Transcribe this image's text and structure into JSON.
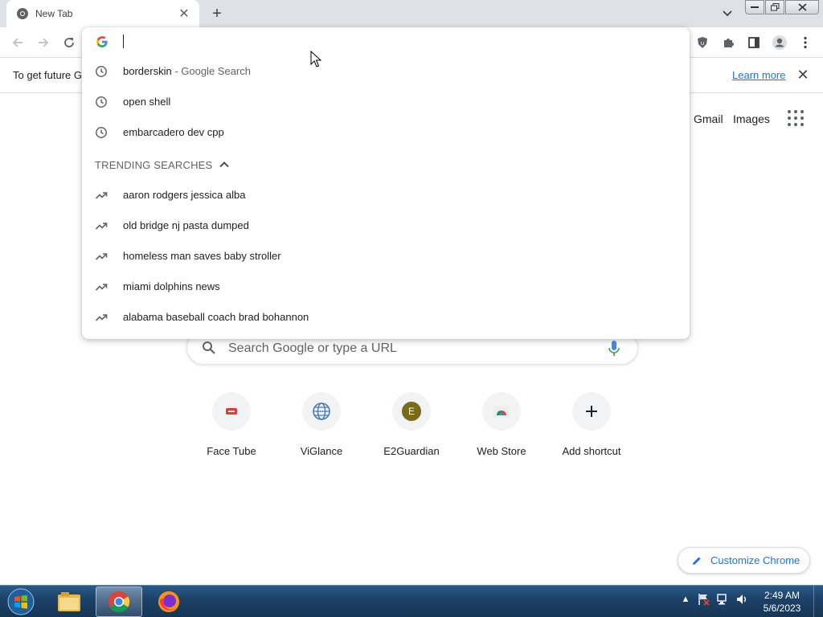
{
  "tab": {
    "title": "New Tab"
  },
  "infobar": {
    "message": "To get future G",
    "learn_more": "Learn more"
  },
  "omnibox": {
    "value": "",
    "suggestions": [
      {
        "text": "borderskin",
        "suffix": " - Google Search",
        "icon": "history-clock-icon"
      },
      {
        "text": "open shell",
        "suffix": "",
        "icon": "history-clock-icon"
      },
      {
        "text": "embarcadero dev cpp",
        "suffix": "",
        "icon": "history-clock-icon"
      }
    ],
    "trending_header": "TRENDING SEARCHES",
    "trending": [
      {
        "text": "aaron rodgers jessica alba",
        "icon": "trending-arrow-icon"
      },
      {
        "text": "old bridge nj pasta dumped",
        "icon": "trending-arrow-icon"
      },
      {
        "text": "homeless man saves baby stroller",
        "icon": "trending-arrow-icon"
      },
      {
        "text": "miami dolphins news",
        "icon": "trending-arrow-icon"
      },
      {
        "text": "alabama baseball coach brad bohannon",
        "icon": "trending-arrow-icon"
      }
    ]
  },
  "ntp": {
    "links": {
      "gmail": "Gmail",
      "images": "Images"
    },
    "search_placeholder": "Search Google or type a URL",
    "shortcuts": [
      {
        "label": "Face Tube",
        "icon": "facetube-icon"
      },
      {
        "label": "ViGlance",
        "icon": "globe-icon"
      },
      {
        "label": "E2Guardian",
        "icon": "letter-e-icon",
        "letter": "E"
      },
      {
        "label": "Web Store",
        "icon": "webstore-icon"
      },
      {
        "label": "Add shortcut",
        "icon": "plus-icon"
      }
    ],
    "customize": "Customize Chrome"
  },
  "taskbar": {
    "time": "2:49 AM",
    "date": "5/6/2023"
  },
  "colors": {
    "accent": "#1a73e8",
    "tabstrip": "#dee1e6",
    "taskbar": "#1c4066"
  }
}
